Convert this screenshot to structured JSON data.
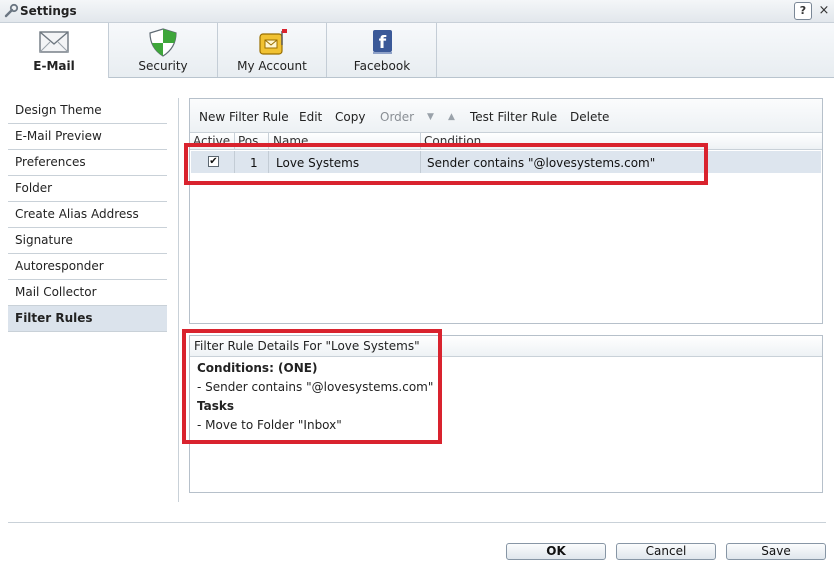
{
  "window": {
    "title": "Settings",
    "help_glyph": "?",
    "close_glyph": "×"
  },
  "tabs": [
    {
      "label": "E-Mail",
      "icon": "envelope-icon",
      "active": true
    },
    {
      "label": "Security",
      "icon": "shield-icon",
      "active": false
    },
    {
      "label": "My Account",
      "icon": "mailbox-icon",
      "active": false
    },
    {
      "label": "Facebook",
      "icon": "facebook-icon",
      "active": false
    }
  ],
  "sidebar": {
    "items": [
      {
        "label": "Design Theme"
      },
      {
        "label": "E-Mail Preview"
      },
      {
        "label": "Preferences"
      },
      {
        "label": "Folder"
      },
      {
        "label": "Create Alias Address"
      },
      {
        "label": "Signature"
      },
      {
        "label": "Autoresponder"
      },
      {
        "label": "Mail Collector"
      },
      {
        "label": "Filter Rules",
        "active": true
      }
    ]
  },
  "toolbar": {
    "new_filter_rule": "New Filter Rule",
    "edit": "Edit",
    "copy": "Copy",
    "order": "Order",
    "test_filter_rule": "Test Filter Rule",
    "delete": "Delete"
  },
  "grid": {
    "columns": [
      "Active",
      "Pos",
      "Name",
      "Condition"
    ],
    "rows": [
      {
        "active": true,
        "active_glyph": "✔",
        "pos": "1",
        "name": "Love Systems",
        "condition": "Sender contains \"@lovesystems.com\""
      }
    ]
  },
  "details": {
    "header": "Filter Rule Details For \"Love Systems\"",
    "conditions_title": "Conditions: (ONE)",
    "condition_line": "- Sender contains \"@lovesystems.com\"",
    "tasks_title": "Tasks",
    "task_line": "- Move to Folder \"Inbox\""
  },
  "footer": {
    "ok": "OK",
    "cancel": "Cancel",
    "save": "Save"
  },
  "colors": {
    "highlight": "#d9232e",
    "selected_row": "#dde5ee",
    "active_nav": "#dbe3ec"
  }
}
